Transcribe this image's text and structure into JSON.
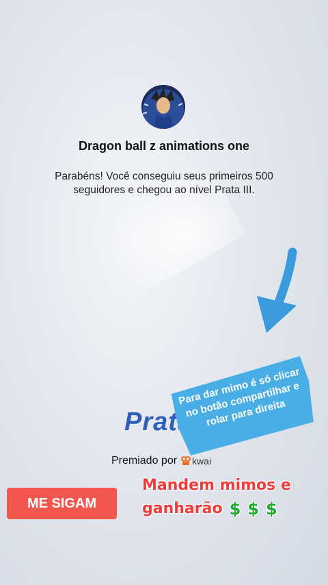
{
  "profile": {
    "name": "Dragon ball z animations one",
    "avatar_icon": "anime-character-avatar"
  },
  "achievement": {
    "message": "Parabéns! Você conseguiu seus primeiros 500 seguidores e chegou ao nível Prata III.",
    "level_name": "Prata"
  },
  "sponsor": {
    "label": "Premiado por",
    "brand": "kwai"
  },
  "overlay": {
    "tip_text": "Para dar  mimo é só clicar no botão compartilhar e rolar para direita",
    "follow_label": "ME SIGAM",
    "promo_line1": "Mandem mimos e",
    "promo_line2": "ganharão",
    "promo_emojis": [
      "$",
      "$",
      "$"
    ]
  },
  "colors": {
    "arrow": "#3a9bdc",
    "tip_bg": "#49aee6",
    "follow_bg": "#f1564f",
    "promo_text": "#ef3d3d",
    "dollar": "#22a82e",
    "level": "#2e5fb8"
  }
}
